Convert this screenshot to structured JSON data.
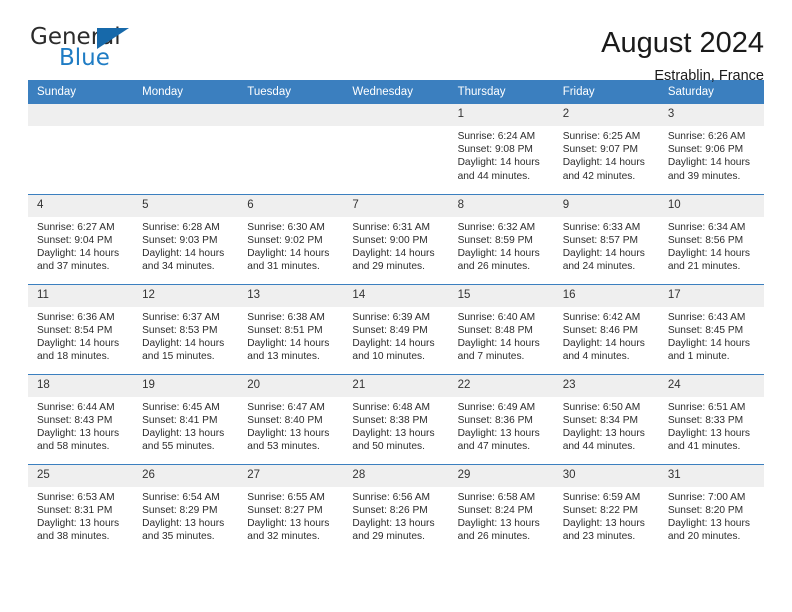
{
  "logo": {
    "word_one": "General",
    "word_two": "Blue",
    "triangle": "blue-triangle",
    "accent_color": "#1769aa",
    "text_color": "#2b2b2b",
    "blue_text_color": "#1f7cc4"
  },
  "header": {
    "month_title": "August 2024",
    "location": "Estrablin, France",
    "header_bg_color": "#3b7fbf",
    "daynum_bg_color": "#efefef"
  },
  "weekday_headers": [
    "Sunday",
    "Monday",
    "Tuesday",
    "Wednesday",
    "Thursday",
    "Friday",
    "Saturday"
  ],
  "weeks": [
    [
      {
        "day": "",
        "lines": []
      },
      {
        "day": "",
        "lines": []
      },
      {
        "day": "",
        "lines": []
      },
      {
        "day": "",
        "lines": []
      },
      {
        "day": "1",
        "lines": [
          "Sunrise: 6:24 AM",
          "Sunset: 9:08 PM",
          "Daylight: 14 hours",
          "and 44 minutes."
        ]
      },
      {
        "day": "2",
        "lines": [
          "Sunrise: 6:25 AM",
          "Sunset: 9:07 PM",
          "Daylight: 14 hours",
          "and 42 minutes."
        ]
      },
      {
        "day": "3",
        "lines": [
          "Sunrise: 6:26 AM",
          "Sunset: 9:06 PM",
          "Daylight: 14 hours",
          "and 39 minutes."
        ]
      }
    ],
    [
      {
        "day": "4",
        "lines": [
          "Sunrise: 6:27 AM",
          "Sunset: 9:04 PM",
          "Daylight: 14 hours",
          "and 37 minutes."
        ]
      },
      {
        "day": "5",
        "lines": [
          "Sunrise: 6:28 AM",
          "Sunset: 9:03 PM",
          "Daylight: 14 hours",
          "and 34 minutes."
        ]
      },
      {
        "day": "6",
        "lines": [
          "Sunrise: 6:30 AM",
          "Sunset: 9:02 PM",
          "Daylight: 14 hours",
          "and 31 minutes."
        ]
      },
      {
        "day": "7",
        "lines": [
          "Sunrise: 6:31 AM",
          "Sunset: 9:00 PM",
          "Daylight: 14 hours",
          "and 29 minutes."
        ]
      },
      {
        "day": "8",
        "lines": [
          "Sunrise: 6:32 AM",
          "Sunset: 8:59 PM",
          "Daylight: 14 hours",
          "and 26 minutes."
        ]
      },
      {
        "day": "9",
        "lines": [
          "Sunrise: 6:33 AM",
          "Sunset: 8:57 PM",
          "Daylight: 14 hours",
          "and 24 minutes."
        ]
      },
      {
        "day": "10",
        "lines": [
          "Sunrise: 6:34 AM",
          "Sunset: 8:56 PM",
          "Daylight: 14 hours",
          "and 21 minutes."
        ]
      }
    ],
    [
      {
        "day": "11",
        "lines": [
          "Sunrise: 6:36 AM",
          "Sunset: 8:54 PM",
          "Daylight: 14 hours",
          "and 18 minutes."
        ]
      },
      {
        "day": "12",
        "lines": [
          "Sunrise: 6:37 AM",
          "Sunset: 8:53 PM",
          "Daylight: 14 hours",
          "and 15 minutes."
        ]
      },
      {
        "day": "13",
        "lines": [
          "Sunrise: 6:38 AM",
          "Sunset: 8:51 PM",
          "Daylight: 14 hours",
          "and 13 minutes."
        ]
      },
      {
        "day": "14",
        "lines": [
          "Sunrise: 6:39 AM",
          "Sunset: 8:49 PM",
          "Daylight: 14 hours",
          "and 10 minutes."
        ]
      },
      {
        "day": "15",
        "lines": [
          "Sunrise: 6:40 AM",
          "Sunset: 8:48 PM",
          "Daylight: 14 hours",
          "and 7 minutes."
        ]
      },
      {
        "day": "16",
        "lines": [
          "Sunrise: 6:42 AM",
          "Sunset: 8:46 PM",
          "Daylight: 14 hours",
          "and 4 minutes."
        ]
      },
      {
        "day": "17",
        "lines": [
          "Sunrise: 6:43 AM",
          "Sunset: 8:45 PM",
          "Daylight: 14 hours",
          "and 1 minute."
        ]
      }
    ],
    [
      {
        "day": "18",
        "lines": [
          "Sunrise: 6:44 AM",
          "Sunset: 8:43 PM",
          "Daylight: 13 hours",
          "and 58 minutes."
        ]
      },
      {
        "day": "19",
        "lines": [
          "Sunrise: 6:45 AM",
          "Sunset: 8:41 PM",
          "Daylight: 13 hours",
          "and 55 minutes."
        ]
      },
      {
        "day": "20",
        "lines": [
          "Sunrise: 6:47 AM",
          "Sunset: 8:40 PM",
          "Daylight: 13 hours",
          "and 53 minutes."
        ]
      },
      {
        "day": "21",
        "lines": [
          "Sunrise: 6:48 AM",
          "Sunset: 8:38 PM",
          "Daylight: 13 hours",
          "and 50 minutes."
        ]
      },
      {
        "day": "22",
        "lines": [
          "Sunrise: 6:49 AM",
          "Sunset: 8:36 PM",
          "Daylight: 13 hours",
          "and 47 minutes."
        ]
      },
      {
        "day": "23",
        "lines": [
          "Sunrise: 6:50 AM",
          "Sunset: 8:34 PM",
          "Daylight: 13 hours",
          "and 44 minutes."
        ]
      },
      {
        "day": "24",
        "lines": [
          "Sunrise: 6:51 AM",
          "Sunset: 8:33 PM",
          "Daylight: 13 hours",
          "and 41 minutes."
        ]
      }
    ],
    [
      {
        "day": "25",
        "lines": [
          "Sunrise: 6:53 AM",
          "Sunset: 8:31 PM",
          "Daylight: 13 hours",
          "and 38 minutes."
        ]
      },
      {
        "day": "26",
        "lines": [
          "Sunrise: 6:54 AM",
          "Sunset: 8:29 PM",
          "Daylight: 13 hours",
          "and 35 minutes."
        ]
      },
      {
        "day": "27",
        "lines": [
          "Sunrise: 6:55 AM",
          "Sunset: 8:27 PM",
          "Daylight: 13 hours",
          "and 32 minutes."
        ]
      },
      {
        "day": "28",
        "lines": [
          "Sunrise: 6:56 AM",
          "Sunset: 8:26 PM",
          "Daylight: 13 hours",
          "and 29 minutes."
        ]
      },
      {
        "day": "29",
        "lines": [
          "Sunrise: 6:58 AM",
          "Sunset: 8:24 PM",
          "Daylight: 13 hours",
          "and 26 minutes."
        ]
      },
      {
        "day": "30",
        "lines": [
          "Sunrise: 6:59 AM",
          "Sunset: 8:22 PM",
          "Daylight: 13 hours",
          "and 23 minutes."
        ]
      },
      {
        "day": "31",
        "lines": [
          "Sunrise: 7:00 AM",
          "Sunset: 8:20 PM",
          "Daylight: 13 hours",
          "and 20 minutes."
        ]
      }
    ]
  ]
}
